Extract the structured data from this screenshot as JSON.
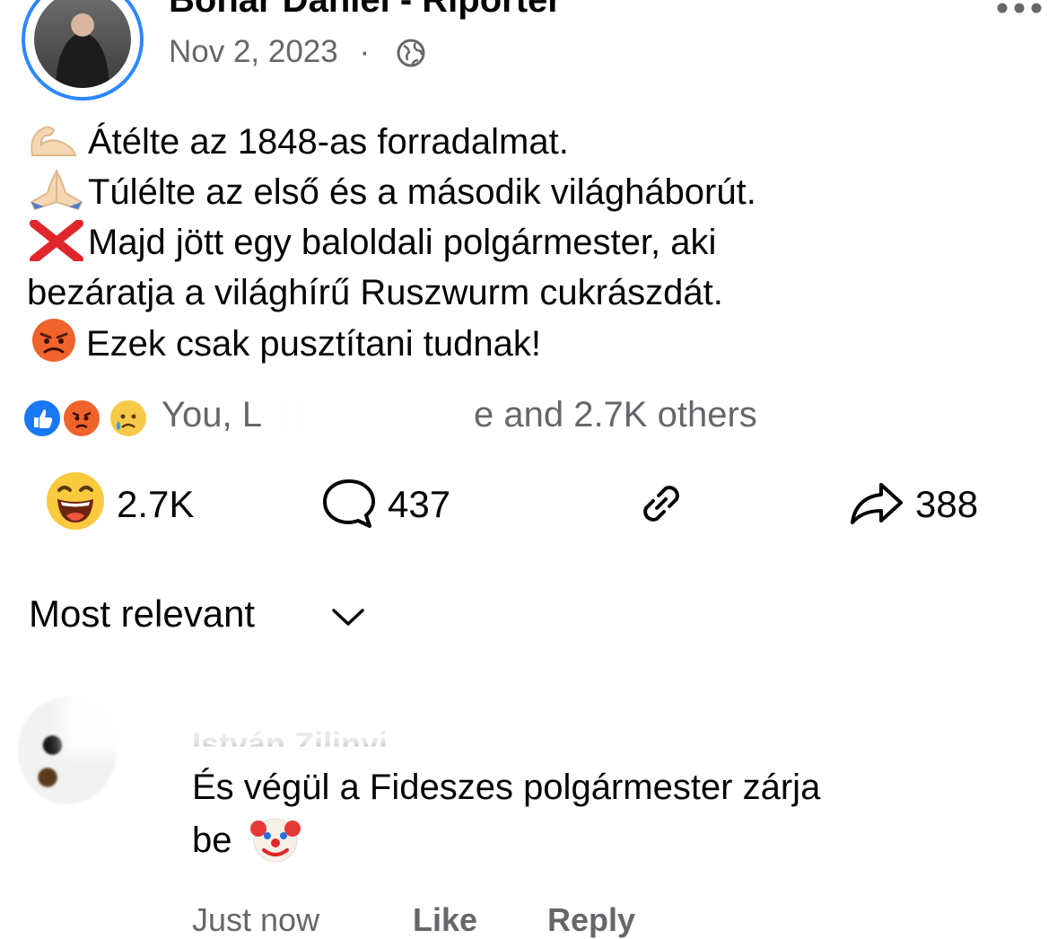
{
  "post": {
    "author": "Bonar Daniel - Riporter",
    "date": "Nov 2, 2023",
    "separator": "·",
    "lines": [
      {
        "emoji": "flexed-biceps",
        "text": "Átélte az 1848-as forradalmat."
      },
      {
        "emoji": "folded-hands",
        "text": "Túlélte az első és a második világháborút."
      },
      {
        "emoji": "cross-mark",
        "text": "Majd jött egy baloldali polgármester, aki"
      },
      {
        "emoji": "",
        "text": "bezáratja a világhírű Ruszwurm cukrászdát."
      },
      {
        "emoji": "angry-face",
        "text": "Ezek csak pusztítani tudnak!"
      }
    ]
  },
  "reactions": {
    "icons": [
      "like-icon",
      "angry-icon",
      "sad-icon"
    ],
    "summary_start": "You, L",
    "summary_end": "e and 2.7K others"
  },
  "actions": {
    "reaction_count": "2.7K",
    "comment_count": "437",
    "share_count": "388"
  },
  "sort": {
    "label": "Most relevant"
  },
  "comment": {
    "name": "István Zilinyi",
    "text_line1": "És végül a Fideszes polgármester zárja",
    "text_line2": "be",
    "time": "Just now",
    "like": "Like",
    "reply": "Reply"
  },
  "colors": {
    "accent": "#2d88ff",
    "secondary_text": "#65676b",
    "primary_text": "#050505"
  }
}
